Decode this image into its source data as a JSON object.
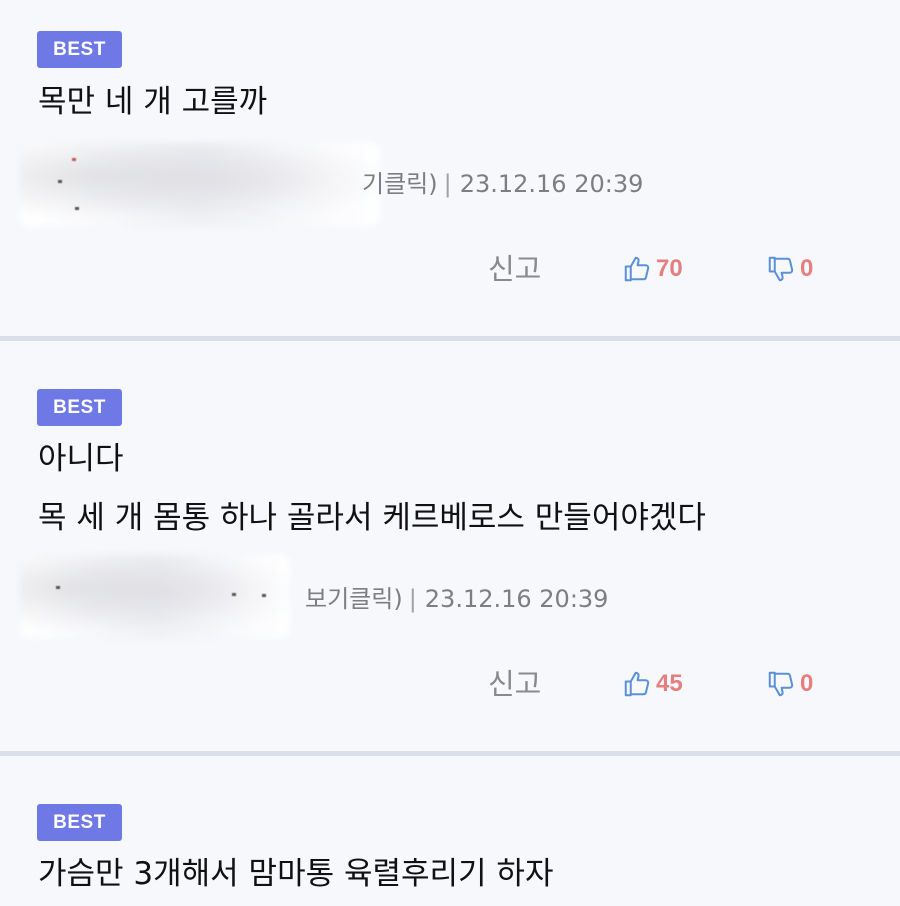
{
  "comments": [
    {
      "badge": "BEST",
      "lines": [
        "목만 네 개 고를까"
      ],
      "meta_tail": "기클릭)",
      "timestamp": "23.12.16 20:39",
      "separator": "|",
      "report_label": "신고",
      "likes": "70",
      "dislikes": "0"
    },
    {
      "badge": "BEST",
      "lines": [
        "아니다",
        "목 세 개 몸통 하나 골라서 케르베로스 만들어야겠다"
      ],
      "meta_tail": "보기클릭)",
      "timestamp": "23.12.16 20:39",
      "separator": "|",
      "report_label": "신고",
      "likes": "45",
      "dislikes": "0"
    },
    {
      "badge": "BEST",
      "lines": [
        "가슴만 3개해서 맘마통 육렬후리기 하자"
      ]
    }
  ],
  "colors": {
    "badge_bg": "#6f79e6",
    "like_icon": "#5b8fd6",
    "dislike_icon": "#5b8fd6",
    "vote_count": "#e57f7f",
    "divider": "#dcdee8"
  },
  "icons": {
    "like": "thumbs-up-icon",
    "dislike": "thumbs-down-icon"
  }
}
